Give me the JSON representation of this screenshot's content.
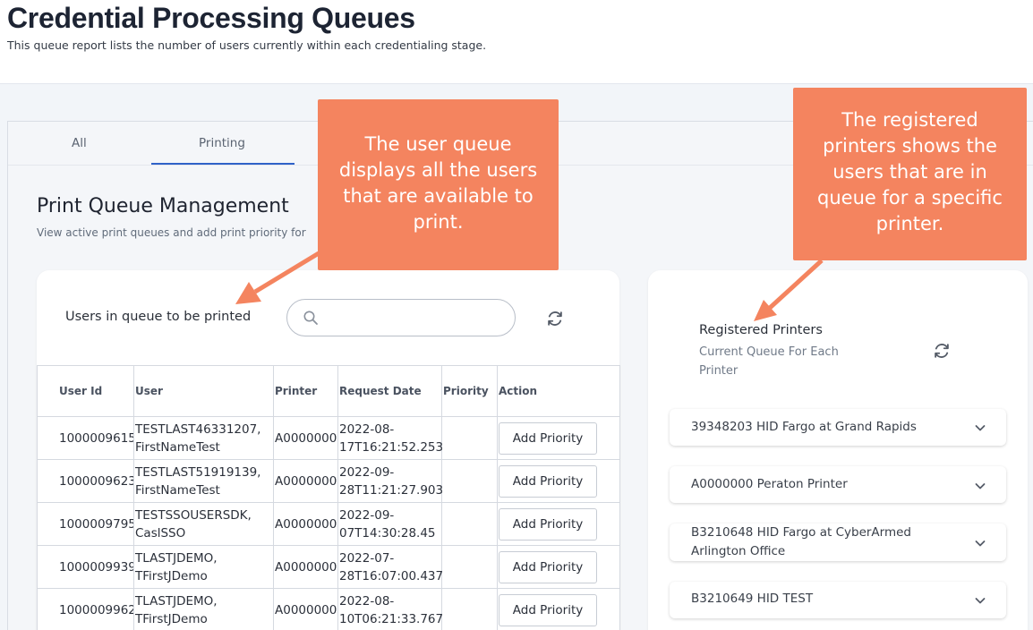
{
  "header": {
    "title": "Credential Processing Queues",
    "subtitle": "This queue report lists the number of users currently within each credentialing stage."
  },
  "tabs": [
    {
      "label": "All",
      "active": false
    },
    {
      "label": "Printing",
      "active": true
    }
  ],
  "section": {
    "title": "Print Queue Management",
    "subtitle": "View active print queues and add print priority for"
  },
  "user_queue": {
    "label": "Users in queue to be printed",
    "search_value": "",
    "columns": [
      "User Id",
      "User",
      "Printer",
      "Request Date",
      "Priority",
      "Action"
    ],
    "rows": [
      {
        "user_id": "1000009615",
        "user": "TESTLAST46331207, FirstNameTest",
        "printer": "A0000000",
        "request_date": "2022-08-17T16:21:52.253",
        "priority": "",
        "action": "Add Priority"
      },
      {
        "user_id": "1000009623",
        "user": "TESTLAST51919139, FirstNameTest",
        "printer": "A0000000",
        "request_date": "2022-09-28T11:21:27.903",
        "priority": "",
        "action": "Add Priority"
      },
      {
        "user_id": "1000009795",
        "user": "TESTSSOUSERSDK, CaslSSO",
        "printer": "A0000000",
        "request_date": "2022-09-07T14:30:28.45",
        "priority": "",
        "action": "Add Priority"
      },
      {
        "user_id": "1000009939",
        "user": "TLASTJDEMO, TFirstJDemo",
        "printer": "A0000000",
        "request_date": "2022-07-28T16:07:00.437",
        "priority": "",
        "action": "Add Priority"
      },
      {
        "user_id": "1000009962",
        "user": "TLASTJDEMO, TFirstJDemo",
        "printer": "A0000000",
        "request_date": "2022-08-10T06:21:33.767",
        "priority": "",
        "action": "Add Priority"
      }
    ]
  },
  "registered_printers": {
    "title": "Registered Printers",
    "subtitle": "Current Queue For Each Printer",
    "items": [
      {
        "label": "39348203 HID Fargo at Grand Rapids"
      },
      {
        "label": "A0000000 Peraton Printer"
      },
      {
        "label": "B3210648 HID Fargo at CyberArmed Arlington Office"
      },
      {
        "label": "B3210649 HID TEST"
      }
    ]
  },
  "callouts": {
    "left": "The user queue displays all the users that are available to print.",
    "right": "The registered printers shows the users that are in queue for a specific printer."
  },
  "colors": {
    "callout": "#f4845f",
    "tab_active": "#2f62c8",
    "background": "#f2f5f9"
  }
}
